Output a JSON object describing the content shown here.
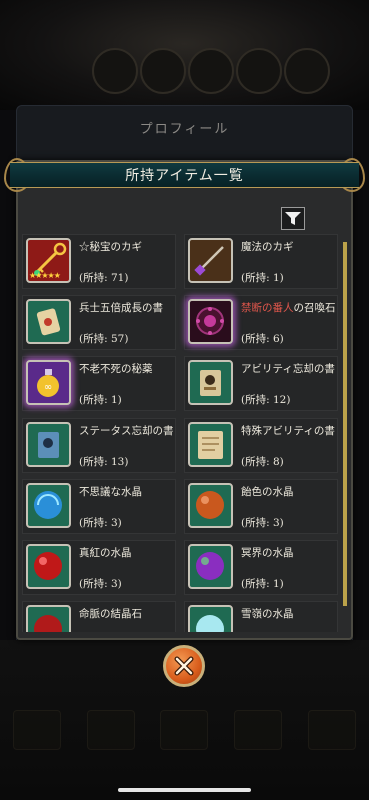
{
  "profile": {
    "title": "プロフィール"
  },
  "dialog": {
    "title": "所持アイテム一覧"
  },
  "items": [
    {
      "name": "☆秘宝のカギ",
      "owned": "(所持: 71)",
      "icon": "gold-key-icon",
      "bg": "#8e1a17"
    },
    {
      "name": "魔法のカギ",
      "owned": "(所持: 1)",
      "icon": "magic-key-icon",
      "bg": "#4a3019"
    },
    {
      "name": "兵士五倍成長の書",
      "owned": "(所持: 57)",
      "icon": "scroll-icon",
      "bg": "#1f6a52"
    },
    {
      "name_red": "禁断の番人",
      "name_rest": "の召喚石",
      "owned": "(所持: 6)",
      "icon": "summon-stone-icon",
      "bg": "#2a0d1c"
    },
    {
      "name": "不老不死の秘薬",
      "owned": "(所持: 1)",
      "icon": "elixir-icon",
      "bg": "#5a2a8a"
    },
    {
      "name": "アビリティ忘却の書",
      "owned": "(所持: 12)",
      "icon": "ability-scroll-icon",
      "bg": "#1f6a52"
    },
    {
      "name": "ステータス忘却の書",
      "owned": "(所持: 13)",
      "icon": "status-scroll-icon",
      "bg": "#1f6a52"
    },
    {
      "name": "特殊アビリティの書",
      "owned": "(所持: 8)",
      "icon": "special-scroll-icon",
      "bg": "#1f6a52"
    },
    {
      "name": "不思議な水晶",
      "owned": "(所持: 3)",
      "icon": "blue-crystal-icon",
      "bg": "#1f6a52"
    },
    {
      "name": "飴色の水晶",
      "owned": "(所持: 3)",
      "icon": "amber-crystal-icon",
      "bg": "#1f6a52"
    },
    {
      "name": "真紅の水晶",
      "owned": "(所持: 3)",
      "icon": "crimson-crystal-icon",
      "bg": "#1f6a52"
    },
    {
      "name": "冥界の水晶",
      "owned": "(所持: 1)",
      "icon": "underworld-crystal-icon",
      "bg": "#1f6a52"
    },
    {
      "name": "命脈の結晶石",
      "owned": "",
      "icon": "life-crystal-icon",
      "bg": "#1f6a52"
    },
    {
      "name": "雪嶺の水晶",
      "owned": "",
      "icon": "snow-crystal-icon",
      "bg": "#1f6a52"
    }
  ],
  "rarity": "★★★★★",
  "colors": {
    "header": "#0a2a2f",
    "gold": "#b89a55",
    "close": "#d95d1c"
  }
}
